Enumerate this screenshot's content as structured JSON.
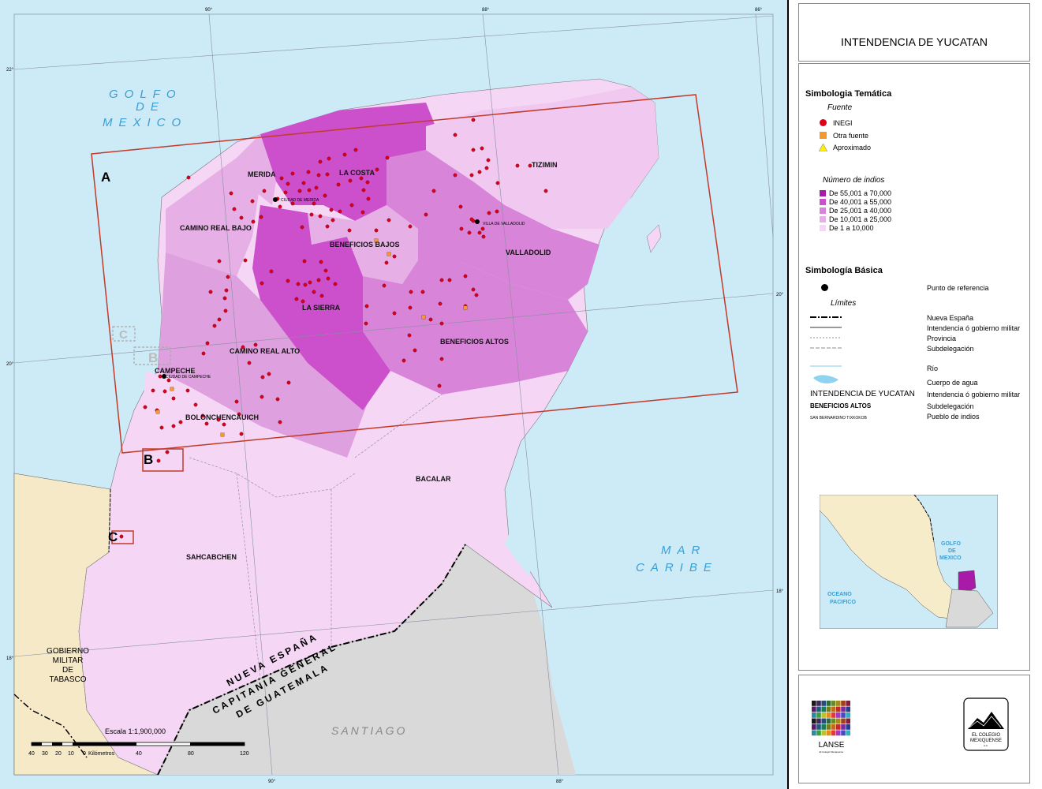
{
  "title": "INTENDENCIA DE YUCATAN",
  "legend": {
    "tematica_title": "Simbologia Temática",
    "fuente_label": "Fuente",
    "fuente_items": [
      {
        "label": "INEGI",
        "color": "#e0001a",
        "shape": "circle"
      },
      {
        "label": "Otra fuente",
        "color": "#f59a2a",
        "shape": "square"
      },
      {
        "label": "Aproximado",
        "color": "#ffee00",
        "shape": "triangle"
      }
    ],
    "indios_label": "Número de indios",
    "indios_items": [
      {
        "label": "De 55,001 a 70,000",
        "color": "#a81aa8"
      },
      {
        "label": "De 40,001 a 55,000",
        "color": "#cc4fcc"
      },
      {
        "label": "De 25,001 a 40,000",
        "color": "#d884d8"
      },
      {
        "label": "De 10,001 a 25,000",
        "color": "#e6b0e6"
      },
      {
        "label": "De 1 a 10,000",
        "color": "#f5d6f5"
      }
    ],
    "basica_title": "Simbología Básica",
    "punto_label": "Punto de referencia",
    "limites_label": "Límites",
    "limites_items": [
      "Nueva España",
      "Intendencia ó gobierno militar",
      "Provincia",
      "Subdelegación"
    ],
    "rio_label": "Río",
    "agua_label": "Cuerpo de agua",
    "text_samples": [
      {
        "sample": "INTENDENCIA DE YUCATAN",
        "desc": "Intendencia ó gobierno militar"
      },
      {
        "sample": "BENEFICIOS ALTOS",
        "desc": "Subdelegación"
      },
      {
        "sample": "SAN BERNARDINO TIXKOKOB",
        "desc": "Pueblo de indios"
      }
    ]
  },
  "inset": {
    "golfo": [
      "GOLFO",
      "DE",
      "MEXICO"
    ],
    "oceano": [
      "OCEANO",
      "PACIFICO"
    ]
  },
  "logos": {
    "lanse": "LANSE",
    "lanse_sub": "El Colegio Mexiquense",
    "colegio": [
      "EL COLEGIO",
      "MEXIQUENSE"
    ],
    "colegio_sub": "A.C."
  },
  "map": {
    "sea_golfo": [
      "GOLFO",
      "DE",
      "MEXICO"
    ],
    "sea_caribe": [
      "MAR",
      "CARIBE"
    ],
    "regions": [
      "MERIDA",
      "LA COSTA",
      "TIZIMIN",
      "CAMINO REAL BAJO",
      "BENEFICIOS BAJOS",
      "VALLADOLID",
      "LA SIERRA",
      "BENEFICIOS ALTOS",
      "CAMINO REAL ALTO",
      "CAMPECHE",
      "BOLONCHENCAUICH",
      "BACALAR",
      "SAHCABCHEN"
    ],
    "cities": [
      "CIUDAD DE MERIDA",
      "VILLA DE VALLADOLID",
      "CIUDAD DE CAMPECHE"
    ],
    "tabasco": [
      "GOBIERNO",
      "MILITAR",
      "DE",
      "TABASCO"
    ],
    "nueva_espana": "NUEVA ESPAÑA",
    "guatemala": [
      "CAPITANIA GENERAL",
      "DE GUATEMALA"
    ],
    "santiago": "SANTIAGO",
    "boxes": [
      "A",
      "B",
      "C"
    ],
    "ghost_boxes": [
      "C",
      "B"
    ],
    "scale_title": "Escala 1:1,900,000",
    "scale_ticks": [
      "40",
      "30",
      "20",
      "10",
      "0",
      "40",
      "80",
      "120"
    ],
    "scale_unit": "Kilómetros",
    "lon_labels": [
      "90°",
      "88°",
      "86°"
    ],
    "lat_labels": [
      "22°",
      "20°",
      "18°"
    ]
  }
}
